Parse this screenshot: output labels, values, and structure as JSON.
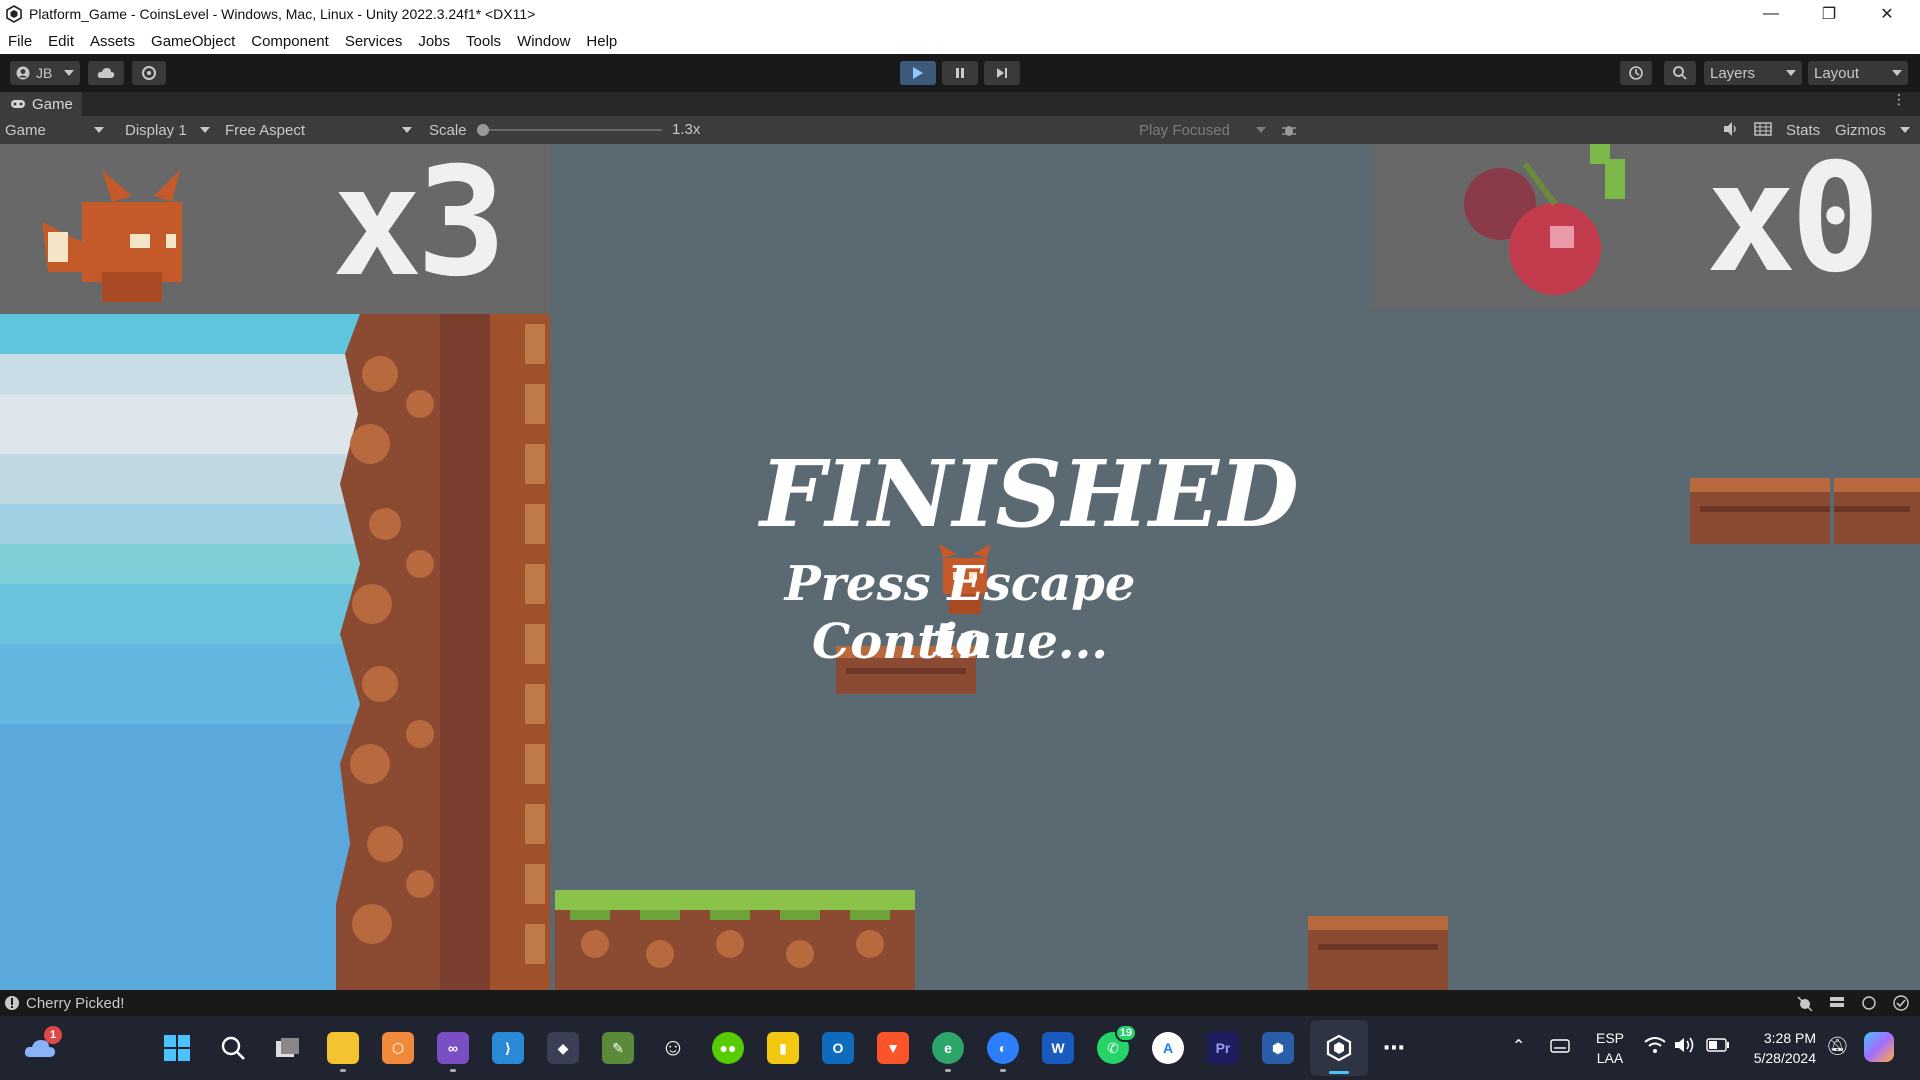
{
  "window": {
    "title": "Platform_Game - CoinsLevel - Windows, Mac, Linux - Unity 2022.3.24f1* <DX11>",
    "controls": [
      "—",
      "❐",
      "✕"
    ]
  },
  "menu": [
    "File",
    "Edit",
    "Assets",
    "GameObject",
    "Component",
    "Services",
    "Jobs",
    "Tools",
    "Window",
    "Help"
  ],
  "toolbar": {
    "account_label": "JB",
    "layers_label": "Layers",
    "layout_label": "Layout"
  },
  "game_tab": {
    "label": "Game"
  },
  "game_bar": {
    "view_mode": "Game",
    "display": "Display 1",
    "aspect": "Free Aspect",
    "scale_label": "Scale",
    "scale_value": "1.3x",
    "play_mode": "Play Focused",
    "stats_label": "Stats",
    "gizmos_label": "Gizmos"
  },
  "game": {
    "lives_text": "x3",
    "cherries_text": "x0",
    "finished_title": "FINISHED",
    "finished_message_line1": "Press Escape to",
    "finished_message_line2": "Continue...",
    "colors": {
      "background": "#5b6a72",
      "sky": "#7cc8e8",
      "grass": "#8bc34a",
      "dirt": "#a0522d"
    }
  },
  "status": {
    "message": "Cherry Picked!"
  },
  "taskbar": {
    "weather_badge": "1",
    "whatsapp_badge": "19",
    "language": "ESP",
    "layout": "LAA",
    "time": "3:28 PM",
    "date": "5/28/2024",
    "icons": [
      "onedrive-icon",
      "windows-start-icon",
      "search-icon",
      "task-view-icon",
      "file-explorer-icon",
      "bridge-icon",
      "visual-studio-icon",
      "vscode-icon",
      "unity-hub-icon",
      "sketch-tool-icon",
      "emoji-app-icon",
      "duolingo-icon",
      "power-bi-icon",
      "outlook-icon",
      "brave-icon",
      "edge-icon",
      "firefox-icon",
      "word-icon",
      "whatsapp-icon",
      "app-store-icon",
      "premiere-icon",
      "blender-icon",
      "unity-icon",
      "more-icon"
    ]
  }
}
